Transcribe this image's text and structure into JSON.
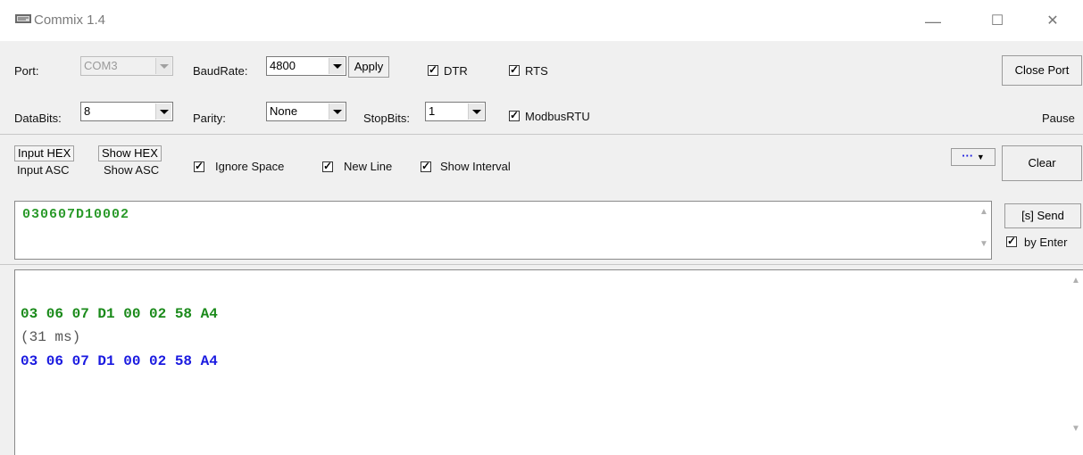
{
  "window": {
    "title": "Commix 1.4",
    "minimize_glyph": "—",
    "maximize_glyph": "☐",
    "close_glyph": "✕"
  },
  "port_row": {
    "port_label": "Port:",
    "port_value": "COM3",
    "baud_label": "BaudRate:",
    "baud_value": "4800",
    "apply_label": "Apply",
    "dtr_label": "DTR",
    "dtr_checked": true,
    "rts_label": "RTS",
    "rts_checked": true,
    "close_port_label": "Close Port"
  },
  "data_row": {
    "databits_label": "DataBits:",
    "databits_value": "8",
    "parity_label": "Parity:",
    "parity_value": "None",
    "stopbits_label": "StopBits:",
    "stopbits_value": "1",
    "modbus_label": "ModbusRTU",
    "modbus_checked": true,
    "pause_label": "Pause"
  },
  "mode_row": {
    "input_hex": "Input HEX",
    "input_asc": "Input ASC",
    "show_hex": "Show HEX",
    "show_asc": "Show ASC",
    "ignore_space_label": "Ignore Space",
    "new_line_label": "New Line",
    "show_interval_label": "Show Interval",
    "more_label": "···",
    "clear_label": "Clear"
  },
  "send": {
    "input_value": "030607D10002",
    "send_label": "[s] Send",
    "by_enter_label": "by Enter",
    "by_enter_checked": true
  },
  "output": {
    "lines": [
      {
        "text": "03 06 07 D1 00 02 58 A4",
        "color": "#1a8a1a"
      },
      {
        "text": "(31 ms)",
        "color": "#555555"
      },
      {
        "text": "03 06 07 D1 00 02 58 A4",
        "color": "#1a1ae0"
      }
    ]
  },
  "colors": {
    "sent_text": "#1a8a1a",
    "received_text": "#1a1ae0",
    "input_text": "#2a9a2a"
  }
}
